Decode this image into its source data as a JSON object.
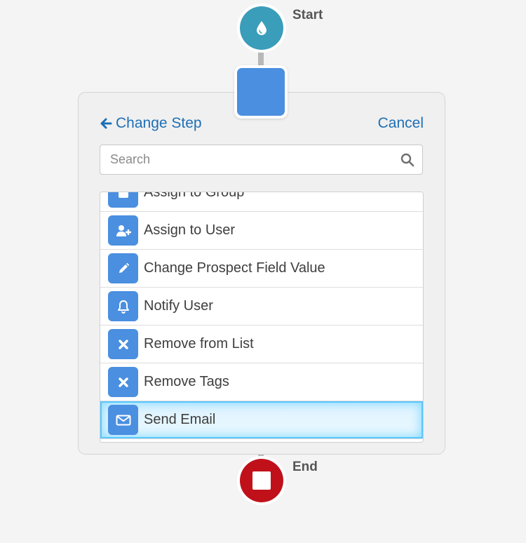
{
  "flow": {
    "start_label": "Start",
    "end_label": "End"
  },
  "panel": {
    "back_label": "Change Step",
    "cancel_label": "Cancel"
  },
  "search": {
    "placeholder": "Search",
    "value": ""
  },
  "actions": {
    "items": [
      {
        "label": "Assign to Group",
        "icon": "group-icon"
      },
      {
        "label": "Assign to User",
        "icon": "add-user-icon"
      },
      {
        "label": "Change Prospect Field Value",
        "icon": "pencil-icon"
      },
      {
        "label": "Notify User",
        "icon": "bell-icon"
      },
      {
        "label": "Remove from List",
        "icon": "x-icon"
      },
      {
        "label": "Remove Tags",
        "icon": "x-icon"
      },
      {
        "label": "Send Email",
        "icon": "envelope-icon"
      }
    ],
    "selected": "Send Email"
  },
  "colors": {
    "start_node": "#3a9dba",
    "end_node": "#c0111b",
    "step_blue": "#4a8fe0",
    "link_blue": "#1e6fb6"
  }
}
